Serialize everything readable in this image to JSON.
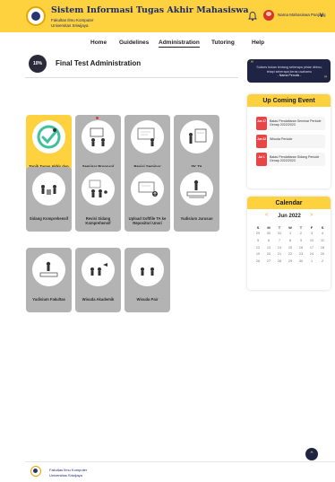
{
  "header": {
    "title": "Sistem Informasi Tugas Akhir Mahasiswa",
    "faculty": "Fakultas Ilmu Komputer",
    "university": "Universitas Sriwijaya",
    "username": "Nama Mahasiswa Panjang",
    "accent_color": "#fdd23e"
  },
  "nav": {
    "items": [
      "Home",
      "Guidelines",
      "Administration",
      "Tutoring",
      "Help"
    ],
    "active": "Administration"
  },
  "page": {
    "progress_label": "10%",
    "progress": 0.1,
    "title": "Final Test Administration"
  },
  "tiles": [
    {
      "label": "Topik Tugas Akhir dan Pembimbing",
      "icon": "check-person-icon",
      "state": "active"
    },
    {
      "label": "Seminar Proposal",
      "icon": "presentation-icon",
      "state": "inactive"
    },
    {
      "label": "Revisi Seminar Proposal",
      "icon": "whiteboard-icon",
      "state": "inactive"
    },
    {
      "label": "SK TA",
      "icon": "document-board-icon",
      "state": "inactive"
    },
    {
      "label": "Sidang Komprehensif",
      "icon": "meeting-icon",
      "state": "inactive"
    },
    {
      "label": "Revisi Sidang Komprehensif",
      "icon": "team-review-icon",
      "state": "inactive"
    },
    {
      "label": "Upload Softfile TA ke Repositori Unsri",
      "icon": "upload-icon",
      "state": "inactive"
    },
    {
      "label": "Yudisium Jurusan",
      "icon": "graduation-stage-icon",
      "state": "inactive"
    },
    {
      "label": "Yudisium Fakultas",
      "icon": "podium-icon",
      "state": "inactive"
    },
    {
      "label": "Wisuda Akademik",
      "icon": "graduation-icon",
      "state": "inactive"
    },
    {
      "label": "Wisuda Pair",
      "icon": "ceremony-icon",
      "state": "inactive"
    }
  ],
  "quote": {
    "text": "Sukses bukan tentang seberapa pintar dirimu, tetapi seberapa keras usahamu",
    "author": "- Nama Penulis -"
  },
  "events": {
    "title": "Up Coming Event",
    "items": [
      {
        "date": "Jun 17",
        "text": "Batas Pendaftaran Seminar Periode Genap 2022/2023"
      },
      {
        "date": "Jun 22",
        "text": "Wisuda Periode"
      },
      {
        "date": "Jul 1",
        "text": "Batas Pendaftaran Sidang Periode Genap 2022/2023"
      }
    ]
  },
  "calendar": {
    "title": "Calendar",
    "month": "Jun 2022",
    "weekdays": [
      "S",
      "M",
      "T",
      "W",
      "T",
      "F",
      "S"
    ],
    "weeks": [
      [
        "29",
        "30",
        "31",
        "1",
        "2",
        "3",
        "4"
      ],
      [
        "5",
        "6",
        "7",
        "8",
        "9",
        "10",
        "11"
      ],
      [
        "12",
        "13",
        "14",
        "15",
        "16",
        "17",
        "18"
      ],
      [
        "19",
        "20",
        "21",
        "22",
        "23",
        "24",
        "25"
      ],
      [
        "26",
        "27",
        "28",
        "29",
        "30",
        "1",
        "2"
      ]
    ]
  },
  "footer": {
    "faculty": "Fakultas Ilmu Komputer",
    "university": "Universitas Sriwijaya"
  }
}
